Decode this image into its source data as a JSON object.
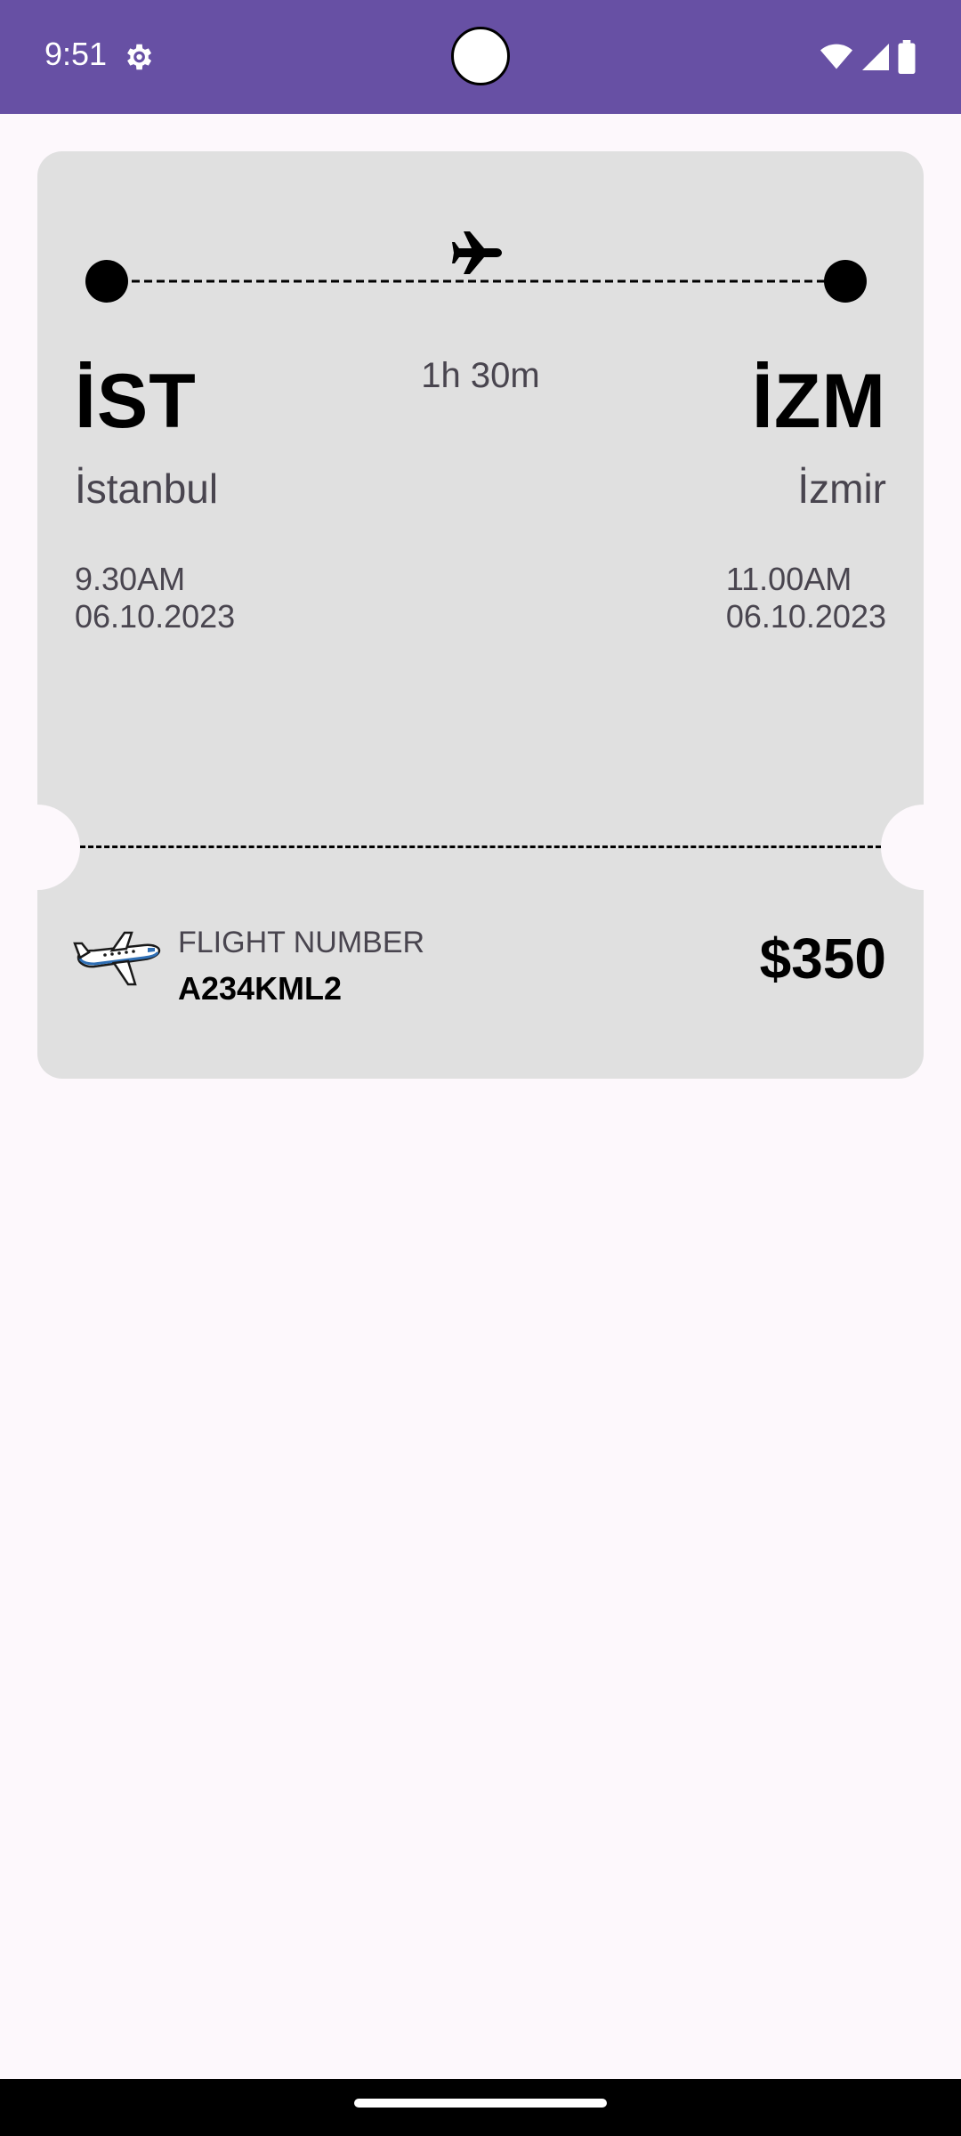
{
  "status_bar": {
    "time": "9:51",
    "icons": [
      "settings-gear-icon",
      "wifi-icon",
      "signal-icon",
      "battery-icon"
    ],
    "background": "#6750A4"
  },
  "ticket": {
    "departure": {
      "code": "İST",
      "city": "İstanbul",
      "time": "9.30AM",
      "date": "06.10.2023"
    },
    "arrival": {
      "code": "İZM",
      "city": "İzmir",
      "time": "11.00AM",
      "date": "06.10.2023"
    },
    "duration": "1h 30m",
    "flight_number_label": "FLIGHT NUMBER",
    "flight_number": "A234KML2",
    "price": "$350",
    "background": "#E0E0E0"
  }
}
